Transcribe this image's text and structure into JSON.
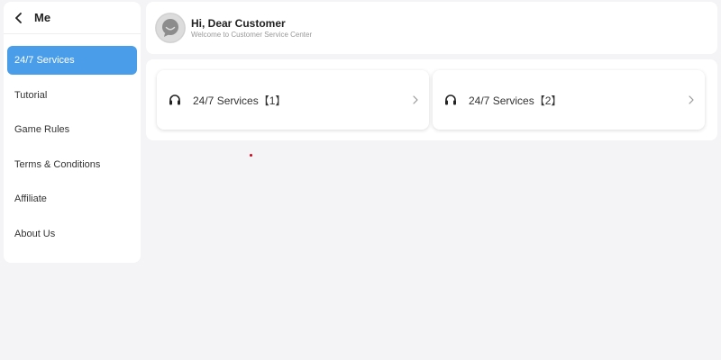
{
  "sidebar": {
    "title": "Me",
    "back_icon": "chevron-left-icon",
    "items": [
      {
        "label": "24/7 Services",
        "active": true
      },
      {
        "label": "Tutorial",
        "active": false
      },
      {
        "label": "Game Rules",
        "active": false
      },
      {
        "label": "Terms & Conditions",
        "active": false
      },
      {
        "label": "Affiliate",
        "active": false
      },
      {
        "label": "About Us",
        "active": false
      }
    ]
  },
  "header": {
    "avatar_icon": "user-avatar-icon",
    "title": "Hi, Dear Customer",
    "subtitle": "Welcome to Customer Service Center"
  },
  "services": [
    {
      "label": "24/7 Services【1】",
      "icon": "headset-icon",
      "chevron": "chevron-right-icon"
    },
    {
      "label": "24/7 Services【2】",
      "icon": "headset-icon",
      "chevron": "chevron-right-icon"
    }
  ],
  "colors": {
    "accent": "#4a9de8",
    "background": "#f4f3f6",
    "card": "#ffffff",
    "dot": "#d0021b"
  }
}
